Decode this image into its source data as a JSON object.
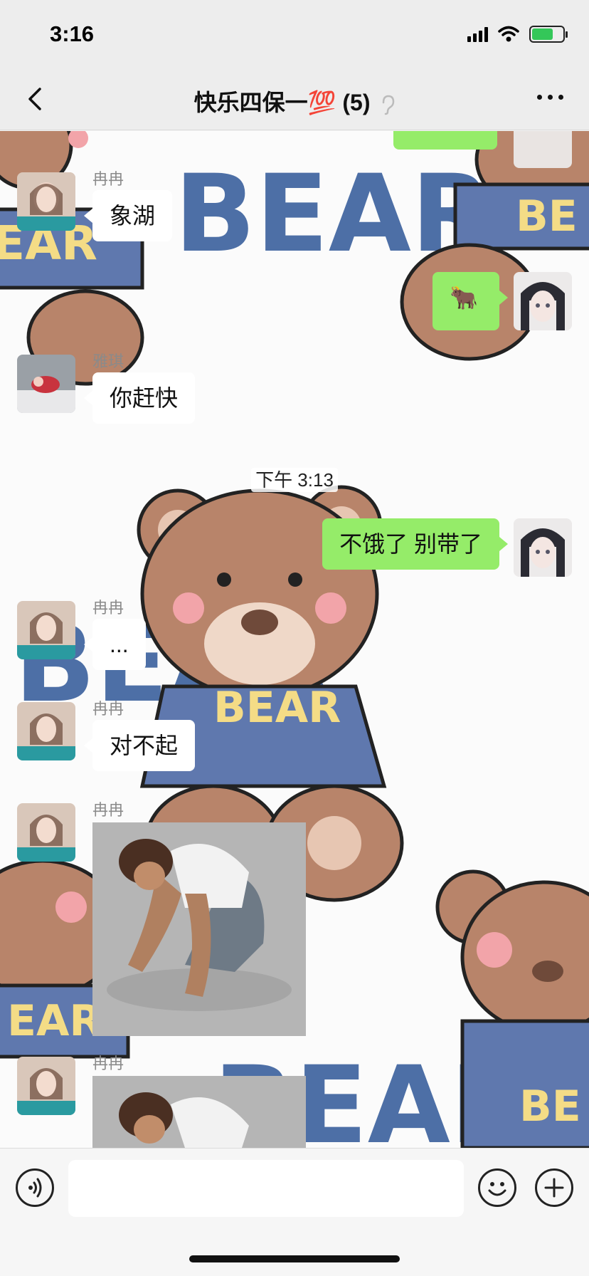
{
  "status_bar": {
    "time": "3:16",
    "battery_level": 0.7,
    "battery_color": "#34c759"
  },
  "nav": {
    "title": "快乐四保一💯 (5)",
    "back_icon": "chevron-left-icon",
    "more_icon": "more-dots-icon",
    "mute_icon": "ear-icon"
  },
  "chat": {
    "wallpaper_text": "BEAR",
    "messages": [
      {
        "sender": "冉冉",
        "text": "象湖"
      },
      {
        "text": "🐂"
      },
      {
        "sender": "雅琪",
        "text": "你赶快"
      },
      {
        "time": "下午 3:13"
      },
      {
        "text": "不饿了 别带了"
      },
      {
        "sender": "冉冉",
        "text": "..."
      },
      {
        "sender": "冉冉",
        "text": "对不起"
      },
      {
        "sender": "冉冉",
        "image": "kneeling-man-sticker"
      },
      {
        "sender": "冉冉",
        "image": "kneeling-man-sticker"
      }
    ]
  },
  "input_bar": {
    "voice_icon": "voice-icon",
    "emoji_icon": "smiley-icon",
    "plus_icon": "plus-icon",
    "input_value": ""
  },
  "colors": {
    "outgoing_bubble": "#95ec69",
    "incoming_bubble": "#ffffff",
    "bar_background": "#ededed"
  }
}
